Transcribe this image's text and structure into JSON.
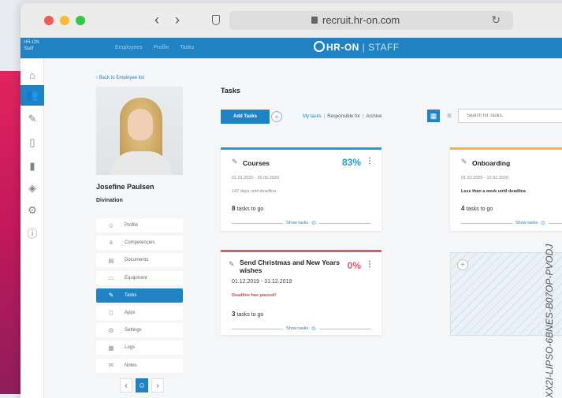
{
  "browser": {
    "url": "recruit.hr-on.com",
    "back_glyph": "‹",
    "forward_glyph": "›",
    "reload_glyph": "↻"
  },
  "appbar": {
    "brand_small": "HR-ON Staff",
    "nav": [
      "Employees",
      "Profile",
      "Tasks"
    ],
    "logo_name": "HR-ON",
    "logo_suffix": " | STAFF"
  },
  "sidebar": {
    "icons": [
      "home-icon",
      "users-icon",
      "pen-icon",
      "file-icon",
      "device-icon",
      "graduation-icon",
      "gear-icon",
      "info-icon"
    ],
    "glyphs": [
      "⌂",
      "👥",
      "✎",
      "▯",
      "▮",
      "◈",
      "⚙",
      "ⓘ"
    ],
    "active_index": 1
  },
  "employee": {
    "back_link": "Back to Employee list",
    "name": "Josefine Paulsen",
    "department": "Divination"
  },
  "menu": {
    "items": [
      {
        "label": "Profile",
        "glyph": "☺"
      },
      {
        "label": "Competencies",
        "glyph": "⚘"
      },
      {
        "label": "Documents",
        "glyph": "▤"
      },
      {
        "label": "Equipment",
        "glyph": "▭"
      },
      {
        "label": "Tasks",
        "glyph": "✎"
      },
      {
        "label": "Apps",
        "glyph": "▯"
      },
      {
        "label": "Settings",
        "glyph": "⚙"
      },
      {
        "label": "Logs",
        "glyph": "▦"
      },
      {
        "label": "Notes",
        "glyph": "✉"
      }
    ],
    "active_index": 4
  },
  "pager": {
    "prev": "‹",
    "current": "☺",
    "next": "›"
  },
  "tasks": {
    "title": "Tasks",
    "add_button": "Add Tasks",
    "add_glyph": "+",
    "filters": {
      "my": "My tasks",
      "sep": "|",
      "responsible": "Responsible for",
      "archive": "Archive"
    },
    "search_placeholder": "Search for Tasks..",
    "view_grid_glyph": "▦",
    "view_list_glyph": "≡"
  },
  "cards": [
    {
      "title": "Courses",
      "percent": "83%",
      "dates": "01.01.2020 - 30.06.2020",
      "deadline": "147 days until deadline",
      "count": "8",
      "count_suffix": " tasks to go",
      "show": "Show tasks"
    },
    {
      "title": "Onboarding",
      "dates": "01.02.2020 - 10.02.2020",
      "deadline": "Less than a week until deadline",
      "count": "4",
      "count_suffix": " tasks to go",
      "show": "Show tasks"
    },
    {
      "title_line1": "Send Christmas and New Years",
      "title_line2": "wishes",
      "percent": "0%",
      "dates": "01.12.2019 - 31.12.2019",
      "deadline": "Deadline has passed!",
      "count": "3",
      "count_suffix": " tasks to go",
      "show": "Show tasks"
    }
  ],
  "colors": {
    "accent": "#1f83c3",
    "blue_card": "#1f9bd6",
    "red_card": "#e05a64",
    "yellow_card": "#f2b733"
  },
  "watermark": "XX2I-LIPSO-6BNES-B07OP-PVODJ"
}
